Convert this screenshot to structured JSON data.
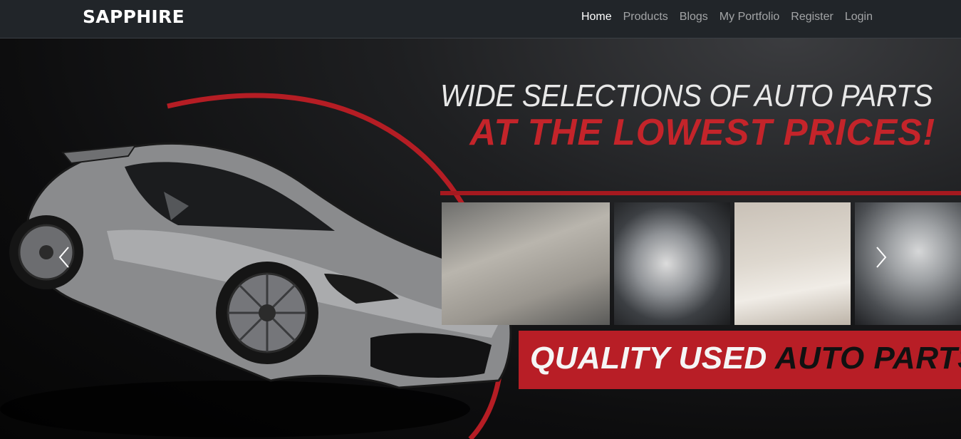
{
  "navbar": {
    "brand": "SAPPHIRE",
    "links": [
      {
        "label": "Home",
        "active": true
      },
      {
        "label": "Products",
        "active": false
      },
      {
        "label": "Blogs",
        "active": false
      },
      {
        "label": "My Portfolio",
        "active": false
      },
      {
        "label": "Register",
        "active": false
      },
      {
        "label": "Login",
        "active": false
      }
    ]
  },
  "carousel": {
    "slide": {
      "headline": "WIDE SELECTIONS OF AUTO PARTS",
      "subheadline": "AT THE LOWEST PRICES!",
      "banner_white": "QUALITY USED",
      "banner_black": "AUTO PARTS",
      "tiles": [
        "car-seat",
        "alternator",
        "bumper",
        "engine"
      ]
    },
    "controls": {
      "prev_icon": "chevron-left-icon",
      "next_icon": "chevron-right-icon"
    }
  },
  "colors": {
    "navbar_bg": "#212529",
    "brand_red": "#b81e26",
    "nav_active": "#ffffff",
    "nav_inactive": "#9b9d9f"
  }
}
